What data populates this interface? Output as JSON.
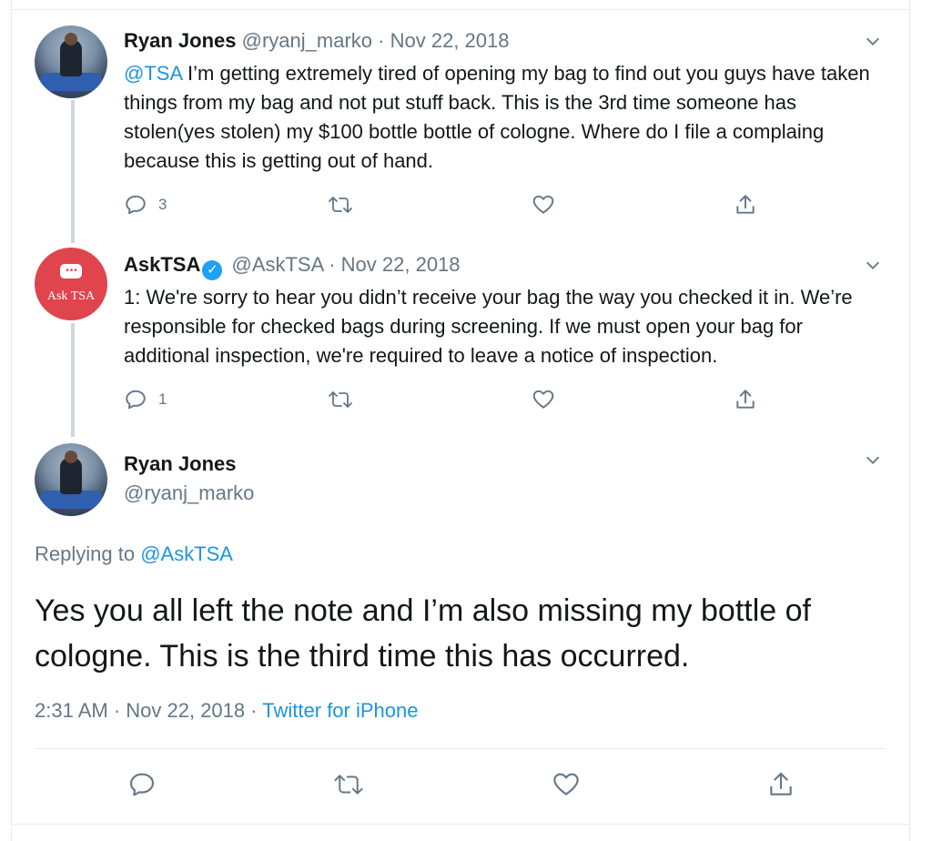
{
  "tweets": [
    {
      "name": "Ryan Jones",
      "handle": "@ryanj_marko",
      "date_sep": "·",
      "date": "Nov 22, 2018",
      "mention": "@TSA",
      "text": " I’m getting extremely tired of opening my bag to find out you guys have taken things from my bag and not put stuff back. This is the 3rd time someone has stolen(yes stolen) my $100 bottle bottle of cologne. Where do I file a complaing because this is getting out of hand.",
      "reply_count": "3"
    },
    {
      "name": "AskTSA",
      "verified": true,
      "handle": "@AskTSA",
      "date_sep": "·",
      "date": "Nov 22, 2018",
      "text": "1: We're sorry to hear you didn’t receive your bag the way you checked it in. We’re responsible for checked bags during screening. If we must open your bag for additional inspection, we're required to leave a notice of inspection.",
      "reply_count": "1",
      "avatar_label": "Ask TSA"
    }
  ],
  "main_tweet": {
    "name": "Ryan Jones",
    "handle": "@ryanj_marko",
    "replying_prefix": "Replying to ",
    "replying_handle": "@AskTSA",
    "text": "Yes you all left the note and I’m also missing my bottle of cologne. This is the third time this has occurred.",
    "time": "2:31 AM · Nov 22, 2018 · ",
    "source": "Twitter for iPhone"
  },
  "icons": {
    "reply": "reply-icon",
    "retweet": "retweet-icon",
    "like": "heart-icon",
    "share": "share-icon",
    "caret": "chevron-down-icon",
    "verified": "verified-badge-icon"
  },
  "colors": {
    "link": "#1b95e0",
    "muted": "#657786",
    "text": "#14171a",
    "verified": "#1da1f2",
    "tsa_red": "#e0454e"
  }
}
